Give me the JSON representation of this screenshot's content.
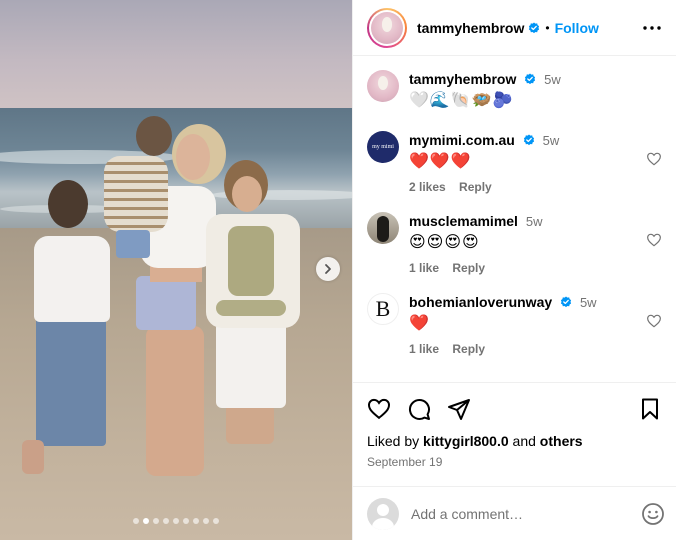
{
  "post": {
    "author": "tammyhembrow",
    "follow_label": "Follow",
    "bullet": "•",
    "image_dots_total": 9,
    "image_dots_active_index": 1
  },
  "caption": {
    "user": "tammyhembrow",
    "time": "5w",
    "text": "🤍🌊🐚🪺🫐"
  },
  "comments": [
    {
      "user": "mymimi.com.au",
      "avatar_text": "my mimi",
      "verified": true,
      "time": "5w",
      "text": "❤️❤️❤️",
      "likes": "2 likes",
      "reply": "Reply"
    },
    {
      "user": "musclemamimel",
      "verified": false,
      "time": "5w",
      "text": "😍😍😍😍",
      "likes": "1 like",
      "reply": "Reply"
    },
    {
      "user": "bohemianloverunway",
      "avatar_text": "B",
      "verified": true,
      "time": "5w",
      "text": "❤️",
      "likes": "1 like",
      "reply": "Reply"
    }
  ],
  "engagement": {
    "liked_by_prefix": "Liked by ",
    "liked_by_user": "kittygirl800.0",
    "liked_by_and": " and ",
    "liked_by_others": "others",
    "date": "September 19"
  },
  "add_comment": {
    "placeholder": "Add a comment…"
  },
  "icons": {
    "verified": "verified-badge-icon",
    "more": "more-options-icon",
    "next": "chevron-right-icon",
    "like": "heart-icon",
    "comment": "comment-icon",
    "share": "share-icon",
    "save": "bookmark-icon",
    "emoji": "emoji-icon"
  },
  "colors": {
    "accent": "#0095f6",
    "secondary_text": "#737373",
    "divider": "#efefef",
    "verified": "#0095f6"
  }
}
